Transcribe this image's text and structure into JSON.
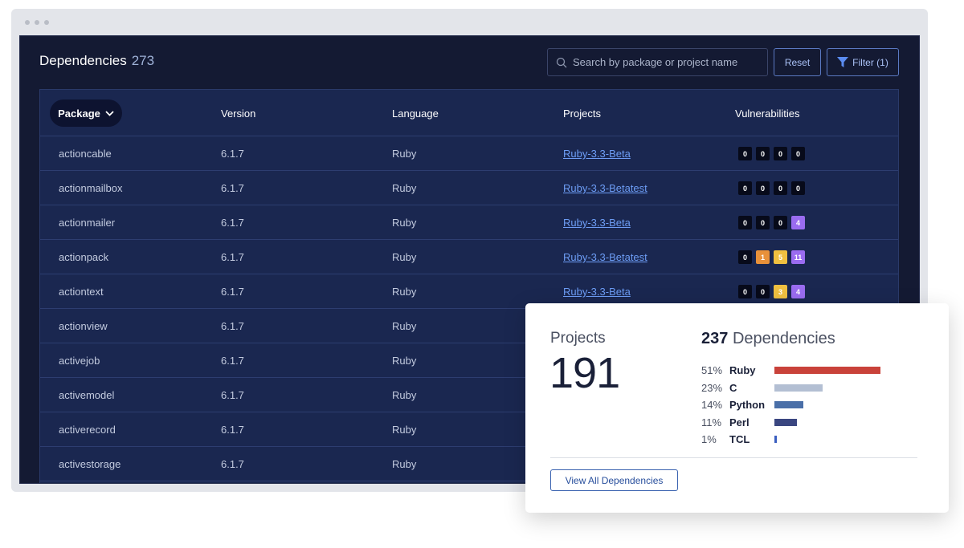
{
  "header": {
    "title": "Dependencies",
    "count": "273"
  },
  "search": {
    "placeholder": "Search by package or project name"
  },
  "buttons": {
    "reset": "Reset",
    "filter": "Filter (1)"
  },
  "table": {
    "columns": [
      "Package",
      "Version",
      "Language",
      "Projects",
      "Vulnerabilities"
    ],
    "rows": [
      {
        "package": "actioncable",
        "version": "6.1.7",
        "language": "Ruby",
        "project": "Ruby-3.3-Beta",
        "vulns": [
          "0",
          "0",
          "0",
          "0"
        ]
      },
      {
        "package": "actionmailbox",
        "version": "6.1.7",
        "language": "Ruby",
        "project": "Ruby-3.3-Betatest",
        "vulns": [
          "0",
          "0",
          "0",
          "0"
        ]
      },
      {
        "package": "actionmailer",
        "version": "6.1.7",
        "language": "Ruby",
        "project": "Ruby-3.3-Beta",
        "vulns": [
          "0",
          "0",
          "0",
          "4"
        ]
      },
      {
        "package": "actionpack",
        "version": "6.1.7",
        "language": "Ruby",
        "project": "Ruby-3.3-Betatest",
        "vulns": [
          "0",
          "1",
          "5",
          "11"
        ]
      },
      {
        "package": "actiontext",
        "version": "6.1.7",
        "language": "Ruby",
        "project": "Ruby-3.3-Beta",
        "vulns": [
          "0",
          "0",
          "3",
          "4"
        ]
      },
      {
        "package": "actionview",
        "version": "6.1.7",
        "language": "Ruby",
        "project": "",
        "vulns": []
      },
      {
        "package": "activejob",
        "version": "6.1.7",
        "language": "Ruby",
        "project": "",
        "vulns": []
      },
      {
        "package": "activemodel",
        "version": "6.1.7",
        "language": "Ruby",
        "project": "",
        "vulns": []
      },
      {
        "package": "activerecord",
        "version": "6.1.7",
        "language": "Ruby",
        "project": "",
        "vulns": []
      },
      {
        "package": "activestorage",
        "version": "6.1.7",
        "language": "Ruby",
        "project": "",
        "vulns": []
      }
    ],
    "vuln_colors": [
      "#070a1a",
      "#e8913a",
      "#f0c040",
      "#9a6cf0"
    ]
  },
  "card": {
    "projects_label": "Projects",
    "projects_count": "191",
    "deps_count": "237",
    "deps_label": "Dependencies",
    "languages": [
      {
        "pct": "51%",
        "name": "Ruby",
        "share": 51,
        "color": "#c9423a"
      },
      {
        "pct": "23%",
        "name": "C",
        "share": 23,
        "color": "#b3bfd3"
      },
      {
        "pct": "14%",
        "name": "Python",
        "share": 14,
        "color": "#4a6fa8"
      },
      {
        "pct": "11%",
        "name": "Perl",
        "share": 11,
        "color": "#3a4680"
      },
      {
        "pct": "1%",
        "name": "TCL",
        "share": 1,
        "color": "#3a5ec0"
      }
    ],
    "view_all": "View All Dependencies"
  }
}
